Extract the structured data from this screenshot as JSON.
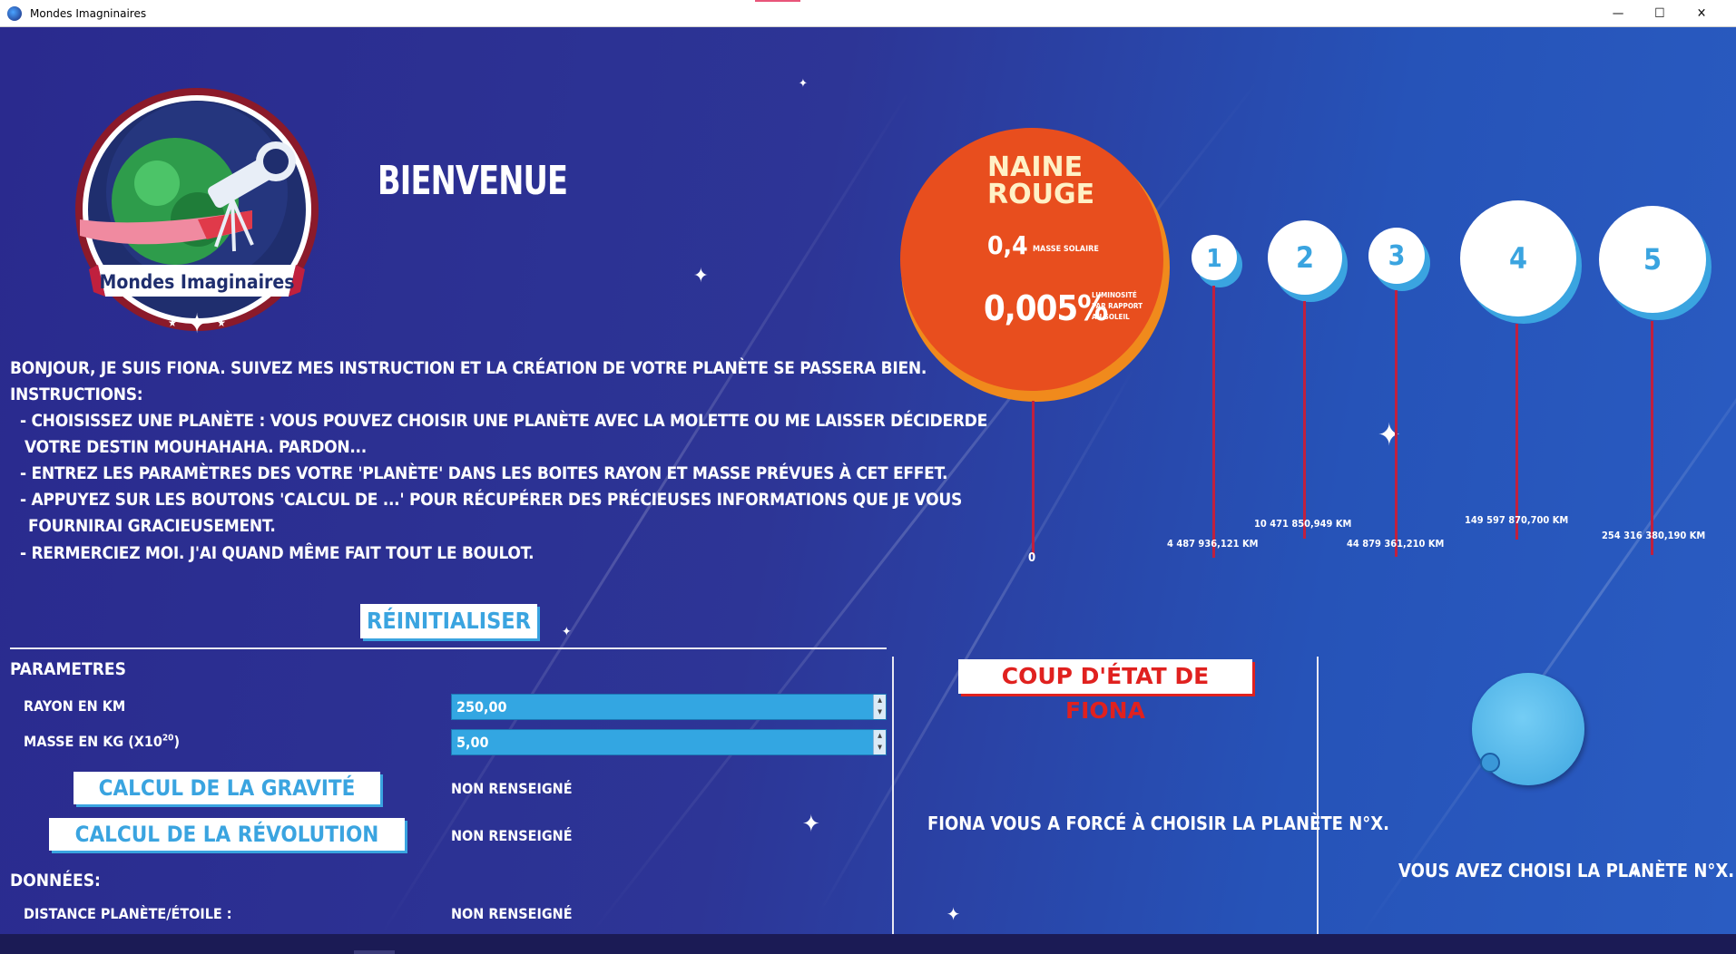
{
  "window": {
    "title": "Mondes Imagninaires",
    "minimize": "—",
    "maximize": "☐",
    "close": "✕"
  },
  "logo": {
    "text": "Mondes Imaginaires"
  },
  "welcome": "BIENVENUE",
  "instructions": {
    "line1": "Bonjour, je suis Fiona. Suivez mes instruction et la création de votre planète se passera bien.",
    "line2": "Instructions:",
    "line3": "- Choisissez une planète : vous pouvez choisir une planète avec la molette ou me laisser déciderde",
    "line4": "votre destin MOUHAHAHA. Pardon...",
    "line5": "- Entrez les paramètres des votre 'planète' dans les boites Rayon et Masse prévues à cet effet.",
    "line6": "- Appuyez sur les boutons 'Calcul de ...' pour récupérer des précieuses informations que je vous",
    "line7": "fournirai gracieusement.",
    "line8": "- Rermerciez moi. J'ai quand même fait tout le boulot."
  },
  "star_info": {
    "name_line1": "NAINE",
    "name_line2": "ROUGE",
    "mass_value": "0,4",
    "mass_label": "MASSE SOLAIRE",
    "lum_value": "0,005%",
    "lum_label1": "LUMINOSITÉ",
    "lum_label2": "PAR RAPPORT",
    "lum_label3": "AU SOLEIL",
    "origin_label": "0"
  },
  "planets": [
    {
      "number": "1",
      "distance": "4 487 936,121 KM"
    },
    {
      "number": "2",
      "distance": "10 471 850,949 KM"
    },
    {
      "number": "3",
      "distance": "44 879 361,210 KM"
    },
    {
      "number": "4",
      "distance": "149 597 870,700 KM"
    },
    {
      "number": "5",
      "distance": "254 316 380,190 KM"
    }
  ],
  "reset_button": "RÉINITIALISER",
  "params": {
    "heading": "Parametres",
    "rayon_label": "Rayon en km",
    "rayon_value": "250,00",
    "masse_label": "Masse en kg (x10",
    "masse_exp": "20",
    "masse_close": ")",
    "masse_value": "5,00"
  },
  "calc": {
    "gravity_button": "CALCUL DE LA GRAVITÉ",
    "gravity_result": "NON RENSEIGNÉ",
    "revolution_button": "CALCUL DE LA RÉVOLUTION",
    "revolution_result": "NON RENSEIGNÉ"
  },
  "donnees": {
    "heading": "Données:",
    "distance_label": "Distance Planète/Étoile :",
    "distance_value": "NON RENSEIGNÉ"
  },
  "fiona": {
    "coup_button": "COUP D'ÉTAT DE FIONA",
    "forced_text": "Fiona vous a forcé à choisir la planète n°X."
  },
  "chooser": {
    "chosen_text": "Vous avez choisi la planète n°X."
  },
  "colors": {
    "accent_blue": "#3aa4e0",
    "star_orange": "#e84e1e",
    "coup_red": "#e0211f",
    "stem_red": "#c0203e"
  }
}
